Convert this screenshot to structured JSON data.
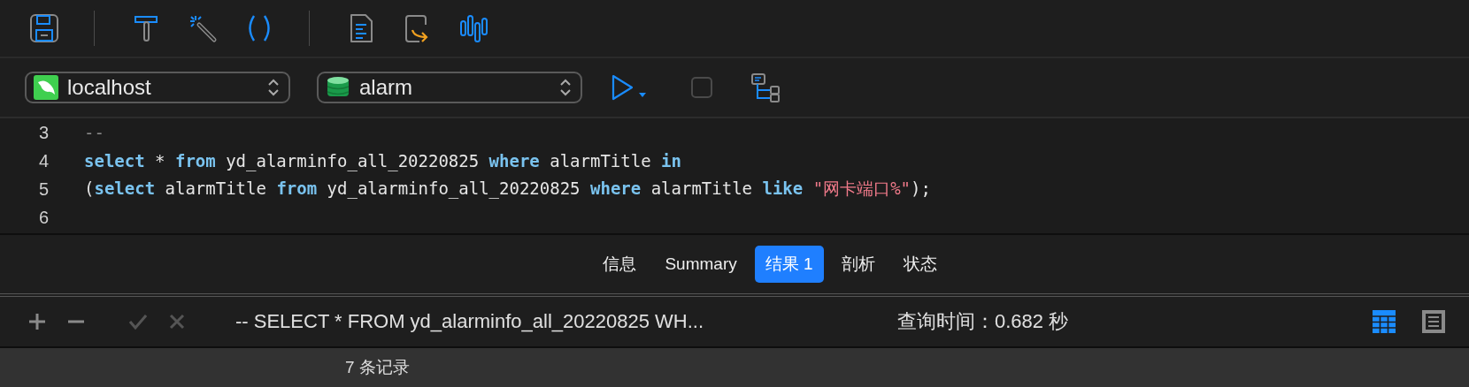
{
  "connection_bar": {
    "connection": "localhost",
    "database": "alarm"
  },
  "editor": {
    "lines": [
      {
        "number": "3",
        "tokens": [
          {
            "kind": "comment",
            "text": "--"
          }
        ]
      },
      {
        "number": "4",
        "tokens": [
          {
            "kind": "keyword",
            "text": "select"
          },
          {
            "kind": "plain",
            "text": " * "
          },
          {
            "kind": "keyword",
            "text": "from"
          },
          {
            "kind": "plain",
            "text": " yd_alarminfo_all_20220825 "
          },
          {
            "kind": "keyword",
            "text": "where"
          },
          {
            "kind": "plain",
            "text": " alarmTitle "
          },
          {
            "kind": "keyword",
            "text": "in"
          }
        ]
      },
      {
        "number": "5",
        "tokens": [
          {
            "kind": "plain",
            "text": "("
          },
          {
            "kind": "keyword",
            "text": "select"
          },
          {
            "kind": "plain",
            "text": " alarmTitle "
          },
          {
            "kind": "keyword",
            "text": "from"
          },
          {
            "kind": "plain",
            "text": " yd_alarminfo_all_20220825 "
          },
          {
            "kind": "keyword",
            "text": "where"
          },
          {
            "kind": "plain",
            "text": " alarmTitle "
          },
          {
            "kind": "keyword",
            "text": "like"
          },
          {
            "kind": "string",
            "text": " \"网卡端口%\""
          },
          {
            "kind": "plain",
            "text": ");"
          }
        ]
      },
      {
        "number": "6"
      }
    ]
  },
  "result_tabs": [
    {
      "label": "信息",
      "selected": false
    },
    {
      "label": "Summary",
      "selected": false
    },
    {
      "label": "结果 1",
      "selected": true
    },
    {
      "label": "剖析",
      "selected": false
    },
    {
      "label": "状态",
      "selected": false
    }
  ],
  "result_bar": {
    "query": "-- SELECT * FROM yd_alarminfo_all_20220825 WH...",
    "query_time": "查询时间：0.682 秒",
    "views": [
      {
        "kind": "grid",
        "selected": true
      },
      {
        "kind": "form",
        "selected": false
      }
    ]
  },
  "status_bar": {
    "records": "7 条记录"
  }
}
